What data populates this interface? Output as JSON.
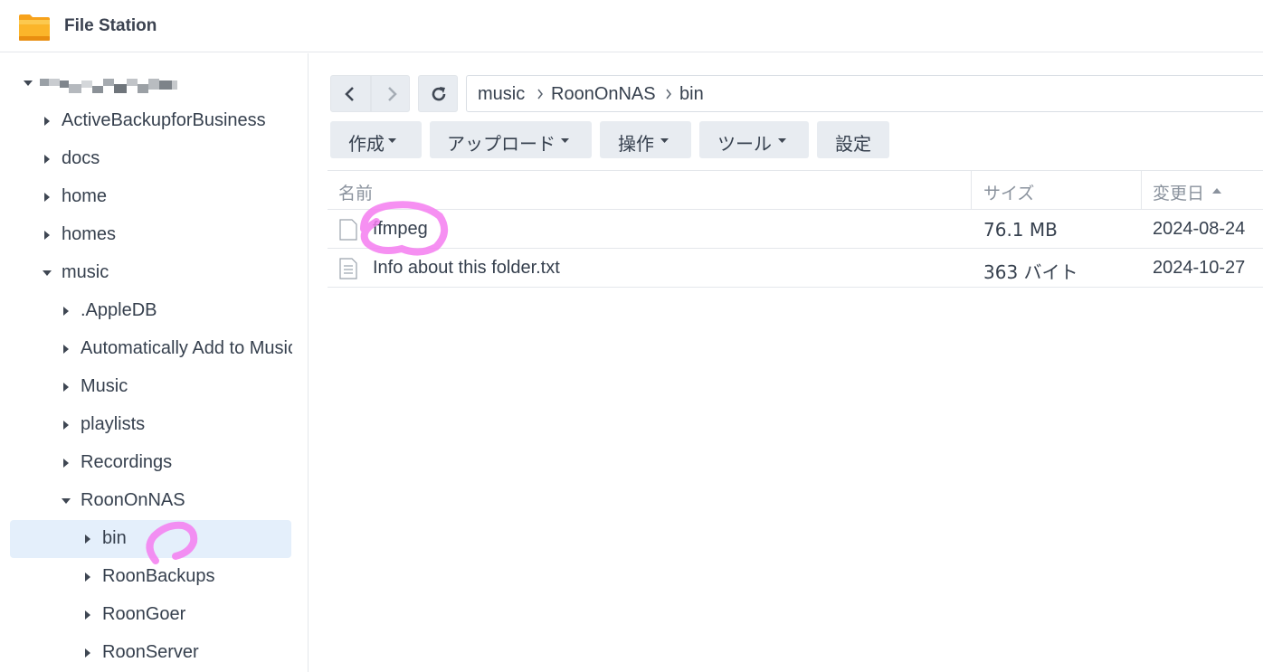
{
  "app": {
    "title": "File Station"
  },
  "sidebar": {
    "items": [
      {
        "label": "ActiveBackupforBusiness",
        "expanded": false
      },
      {
        "label": "docs",
        "expanded": false
      },
      {
        "label": "home",
        "expanded": false
      },
      {
        "label": "homes",
        "expanded": false
      },
      {
        "label": "music",
        "expanded": true
      },
      {
        "label": ".AppleDB",
        "expanded": false
      },
      {
        "label": "Automatically Add to Music",
        "expanded": false
      },
      {
        "label": "Music",
        "expanded": false
      },
      {
        "label": "playlists",
        "expanded": false
      },
      {
        "label": "Recordings",
        "expanded": false
      },
      {
        "label": "RoonOnNAS",
        "expanded": true
      },
      {
        "label": "bin",
        "expanded": false,
        "selected": true
      },
      {
        "label": "RoonBackups",
        "expanded": false
      },
      {
        "label": "RoonGoer",
        "expanded": false
      },
      {
        "label": "RoonServer",
        "expanded": false
      }
    ]
  },
  "breadcrumb": {
    "items": [
      "music",
      "RoonOnNAS",
      "bin"
    ]
  },
  "toolbar": {
    "create_label": "作成",
    "upload_label": "アップロード",
    "action_label": "操作",
    "tools_label": "ツール",
    "settings_label": "設定"
  },
  "columns": {
    "name": "名前",
    "size": "サイズ",
    "modified": "変更日"
  },
  "files": [
    {
      "name": "ffmpeg",
      "size": "76.1 MB",
      "modified": "2024-08-24",
      "icon": "blank-file-icon"
    },
    {
      "name": "Info about this folder.txt",
      "size": "363 バイト",
      "modified": "2024-10-27",
      "icon": "text-file-icon"
    }
  ],
  "colors": {
    "accent_marker": "#f47cf0",
    "selected_bg": "#e4effb",
    "button_bg": "#e8ecf1"
  }
}
